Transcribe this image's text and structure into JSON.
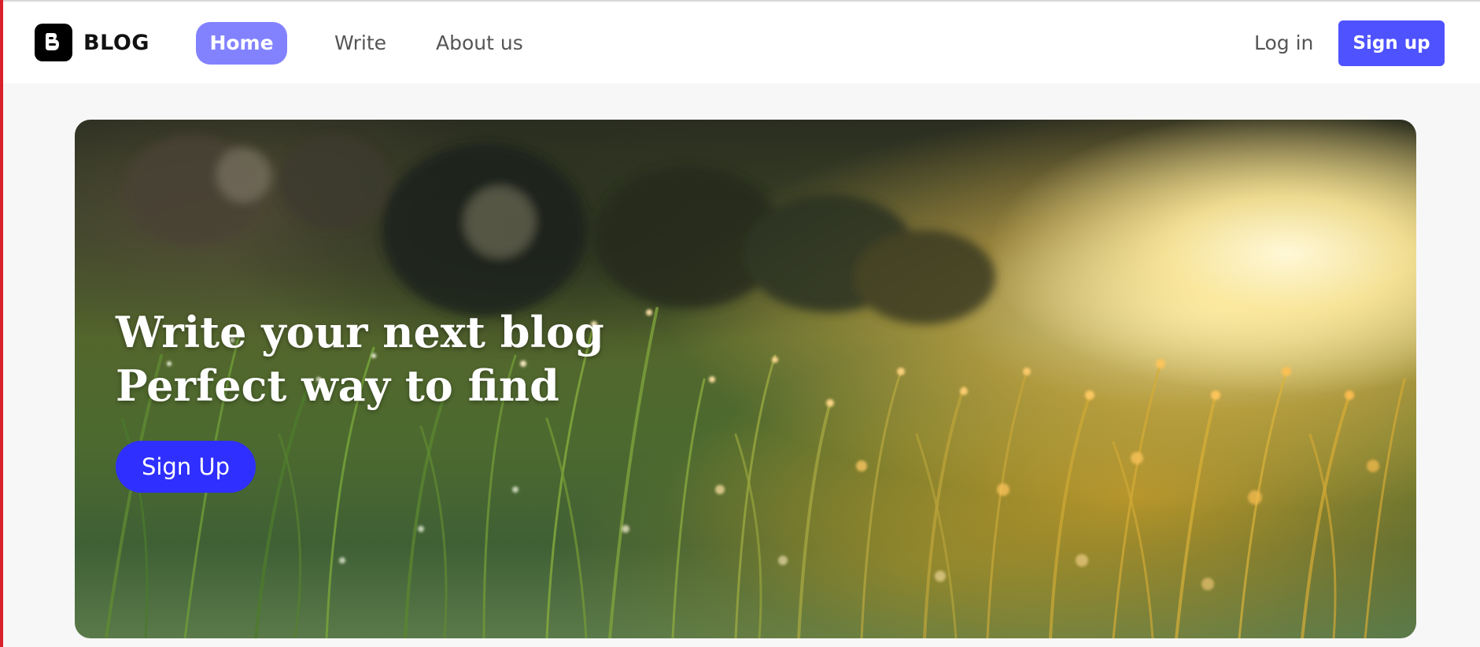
{
  "brand": {
    "name": "BLOG",
    "icon": "blogger-logo-icon"
  },
  "nav": {
    "home": "Home",
    "write": "Write",
    "about": "About us",
    "login": "Log in",
    "signup": "Sign up"
  },
  "hero": {
    "title_line1": "Write your next blog",
    "title_line2": "Perfect way to find",
    "cta": "Sign Up",
    "image": "dewy-grass-sunset-photo"
  },
  "colors": {
    "nav_active": "#8282ff",
    "signup_button": "#4f52ff",
    "hero_cta": "#2f2fff"
  }
}
